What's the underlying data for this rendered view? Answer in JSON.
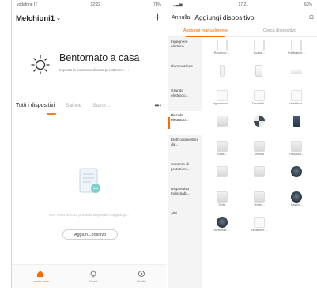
{
  "left": {
    "status": {
      "carrier": "vodafone IT",
      "time": "12:22",
      "battery": "78%"
    },
    "home_name": "Melchioni1",
    "welcome": {
      "title": "Bentornato a casa",
      "subtitle": "Imposta la posizione di casa per ottener..."
    },
    "tabs": [
      "Tutti i dispositivi",
      "Salone",
      "Stanz..."
    ],
    "empty_message": "Non sono ancora presenti dispositivi, aggiungi...",
    "add_button": "Aggiun...positivo",
    "nav": [
      "La mia casa",
      "Smart",
      "Profilo"
    ]
  },
  "right": {
    "status": {
      "time": "17:21",
      "battery": "63%"
    },
    "cancel": "Annulla",
    "title": "Aggiungi dispositivo",
    "tabs": [
      "Aggiungi manualmente",
      "Cerca dispositivo"
    ],
    "categories": [
      "Ingegnere elettrico",
      "Illuminazione",
      "Grande elettrodo...",
      "Piccolo elettrodo...",
      "Elettrodomestici da...",
      "Sensore di protezion...",
      "Dispositivo Indossabi...",
      "Altri"
    ],
    "grid": [
      "Recuerdo ...",
      "Cuarta ...",
      "Purificatore ...",
      "",
      "",
      "",
      "Ingezzonato ...",
      "Deumidifi...",
      "Umidificat...",
      "",
      "",
      "",
      "Ruota ...",
      "Ventola",
      "Riscaldat...",
      "",
      "",
      "",
      "Sede",
      "Tende ...",
      "Rasoio ...",
      "Ricevitore ...",
      "Ventilatore ...",
      ""
    ]
  },
  "colors": {
    "accent": "#ff6a00"
  }
}
